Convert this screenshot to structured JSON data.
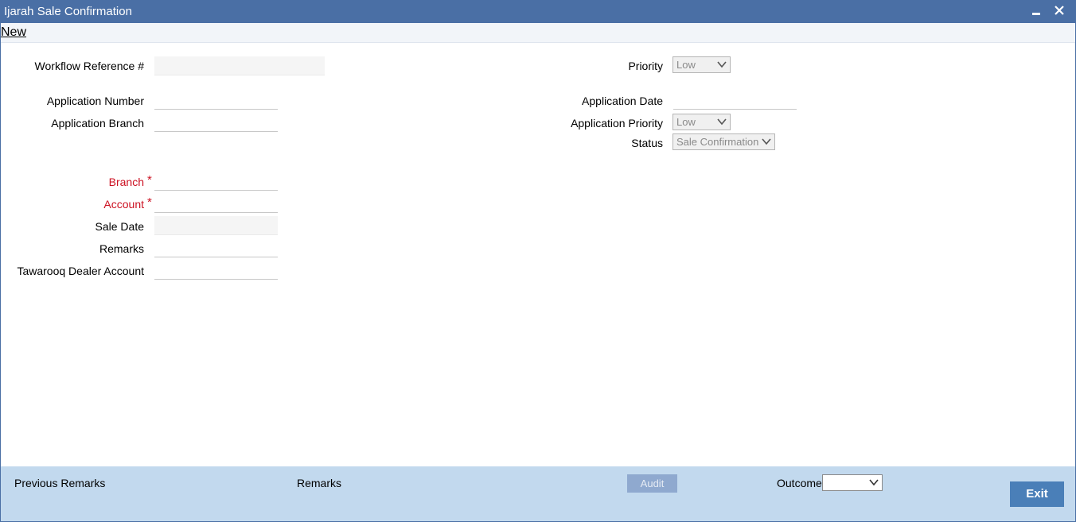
{
  "window": {
    "title": "Ijarah Sale Confirmation"
  },
  "toolbar": {
    "new_label": "New"
  },
  "form": {
    "workflow_reference": {
      "label": "Workflow Reference #",
      "value": ""
    },
    "priority": {
      "label": "Priority",
      "value": "Low"
    },
    "application_number": {
      "label": "Application Number",
      "value": ""
    },
    "application_date": {
      "label": "Application Date",
      "value": ""
    },
    "application_branch": {
      "label": "Application Branch",
      "value": ""
    },
    "application_priority": {
      "label": "Application Priority",
      "value": "Low"
    },
    "status": {
      "label": "Status",
      "value": "Sale Confirmation"
    },
    "branch": {
      "label": "Branch",
      "value": "",
      "required_mark": "*"
    },
    "account": {
      "label": "Account",
      "value": "",
      "required_mark": "*"
    },
    "sale_date": {
      "label": "Sale Date",
      "value": ""
    },
    "remarks": {
      "label": "Remarks",
      "value": ""
    },
    "tawarooq_dealer_account": {
      "label": "Tawarooq Dealer Account",
      "value": ""
    }
  },
  "footer": {
    "previous_remarks_label": "Previous Remarks",
    "remarks_label": "Remarks",
    "audit_label": "Audit",
    "outcome_label": "Outcome",
    "outcome_value": "",
    "exit_label": "Exit"
  },
  "colors": {
    "titlebar": "#4a6fa5",
    "required": "#cc1122",
    "footer": "#c2d9ee",
    "exit_button": "#4a7fb8"
  },
  "icons": {
    "minimize": "minimize-icon",
    "close": "close-icon",
    "dropdown": "chevron-down-icon"
  }
}
